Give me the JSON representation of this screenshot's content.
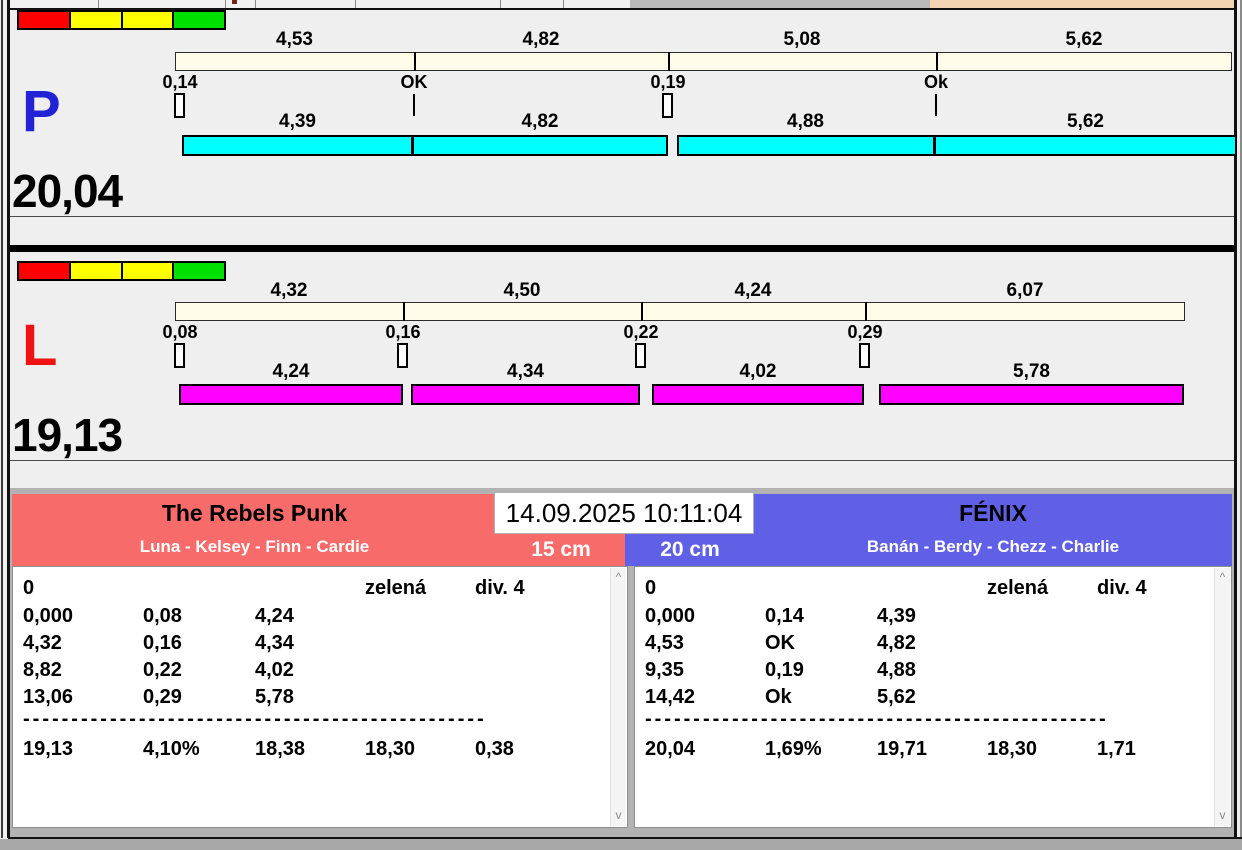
{
  "datetime": "14.09.2025 10:11:04",
  "icons": {
    "scroll_up": "^",
    "scroll_down": "v"
  },
  "colors": {
    "lane_p_bar": "#00ffff",
    "lane_l_bar": "#ff00ff",
    "reference_bar": "#fffdea",
    "traffic_lights": [
      "#ff0000",
      "#ffff00",
      "#ffff00",
      "#00e000"
    ],
    "team_left_header": "#f76b6b",
    "team_right_header": "#6060e6",
    "lane_p_label": "#2323d6",
    "lane_l_label": "#ee1212"
  },
  "lane_p": {
    "label": "P",
    "total": "20,04",
    "upper_splits": [
      "4,53",
      "4,82",
      "5,08",
      "5,62"
    ],
    "exchanges": [
      "0,14",
      "OK",
      "0,19",
      "Ok"
    ],
    "lower_splits": [
      "4,39",
      "4,82",
      "4,88",
      "5,62"
    ]
  },
  "lane_l": {
    "label": "L",
    "total": "19,13",
    "upper_splits": [
      "4,32",
      "4,50",
      "4,24",
      "6,07"
    ],
    "exchanges": [
      "0,08",
      "0,16",
      "0,22",
      "0,29"
    ],
    "lower_splits": [
      "4,24",
      "4,34",
      "4,02",
      "5,78"
    ]
  },
  "team_left": {
    "name": "The Rebels Punk",
    "members": "Luna - Kelsey - Finn - Cardie",
    "hurdle_height": "15 cm",
    "attempt": "0",
    "color_word": "zelená",
    "division": "div. 4",
    "splits": [
      [
        "0,000",
        "0,08",
        "4,24"
      ],
      [
        "4,32",
        "0,16",
        "4,34"
      ],
      [
        "8,82",
        "0,22",
        "4,02"
      ],
      [
        "13,06",
        "0,29",
        "5,78"
      ]
    ],
    "separator": "------------------------------------------------",
    "totals": [
      "19,13",
      "4,10%",
      "18,38",
      "18,30",
      "0,38"
    ]
  },
  "team_right": {
    "name": "FÉNIX",
    "members": "Banán - Berdy - Chezz - Charlie",
    "hurdle_height": "20 cm",
    "attempt": "0",
    "color_word": "zelená",
    "division": "div. 4",
    "splits": [
      [
        "0,000",
        "0,14",
        "4,39"
      ],
      [
        "4,53",
        "OK",
        "4,82"
      ],
      [
        "9,35",
        "0,19",
        "4,88"
      ],
      [
        "14,42",
        "Ok",
        "5,62"
      ]
    ],
    "separator": "------------------------------------------------",
    "totals": [
      "20,04",
      "1,69%",
      "19,71",
      "18,30",
      "1,71"
    ]
  }
}
